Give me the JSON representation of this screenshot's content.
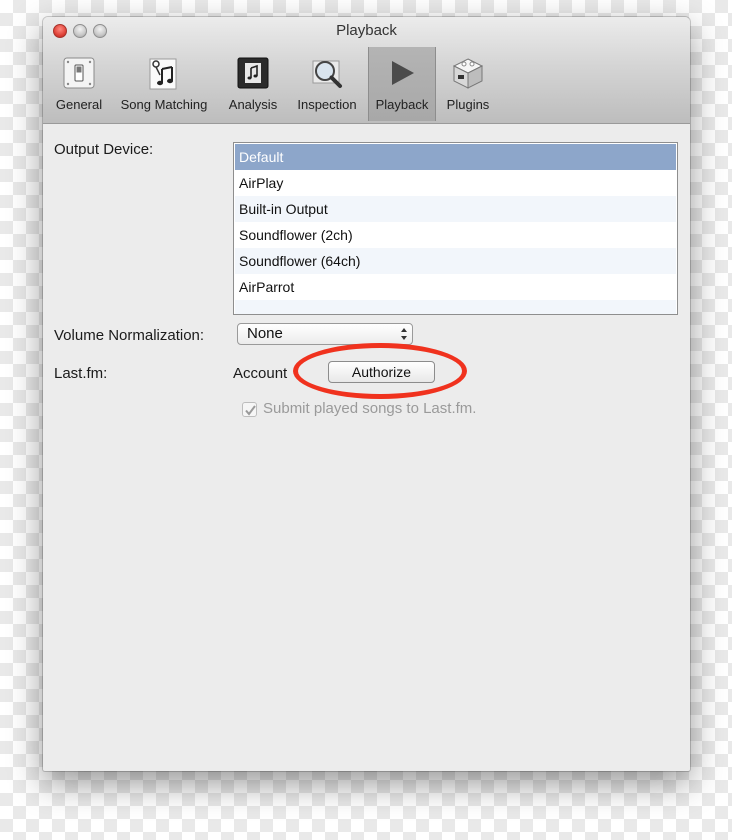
{
  "window": {
    "title": "Playback"
  },
  "toolbar": {
    "items": [
      {
        "label": "General",
        "icon": "switch-icon"
      },
      {
        "label": "Song Matching",
        "icon": "music-notes-icon"
      },
      {
        "label": "Analysis",
        "icon": "music-file-icon"
      },
      {
        "label": "Inspection",
        "icon": "magnifier-icon"
      },
      {
        "label": "Playback",
        "icon": "play-icon",
        "selected": true
      },
      {
        "label": "Plugins",
        "icon": "plugin-cube-icon"
      }
    ]
  },
  "output_device": {
    "label": "Output Device:",
    "options": [
      "Default",
      "AirPlay",
      "Built-in Output",
      "Soundflower (2ch)",
      "Soundflower (64ch)",
      "AirParrot"
    ],
    "selected": "Default"
  },
  "volume_normalization": {
    "label": "Volume Normalization:",
    "value": "None"
  },
  "lastfm": {
    "label": "Last.fm:",
    "account_label": "Account",
    "authorize_label": "Authorize",
    "submit_label": "Submit played songs to Last.fm.",
    "submit_checked": true
  },
  "colors": {
    "selection": "#8da6ca",
    "highlight_ring": "#f0321e",
    "window_bg": "#ececec"
  }
}
